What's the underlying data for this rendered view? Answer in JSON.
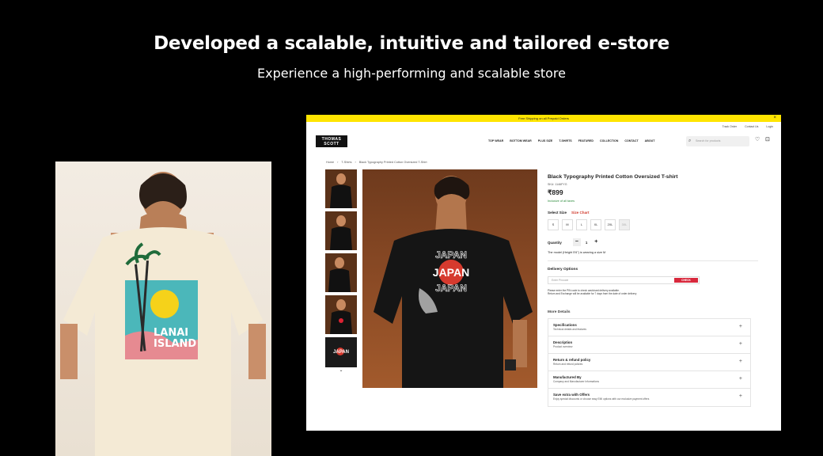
{
  "hero": {
    "title": "Developed a scalable, intuitive and tailored e-store",
    "subtitle": "Experience a high-performing and scalable store"
  },
  "left_photo": {
    "print_text_line1": "LANAI",
    "print_text_line2": "ISLAND"
  },
  "site": {
    "promo": "Free Shipping on all Prepaid Orders",
    "promo_close": "×",
    "top_links": [
      "Track Order",
      "Contact Us",
      "Login"
    ],
    "logo_line1": "THOMAS",
    "logo_line2": "SCOTT",
    "nav": [
      "TOP WEAR",
      "BOTTOM WEAR",
      "PLUS SIZE",
      "T-SHIRTS",
      "FEATURED",
      "COLLECTION",
      "CONTACT",
      "ABOUT"
    ],
    "search_placeholder": "Search for products",
    "breadcrumbs": [
      "Home",
      "T-Shirts",
      "Black Typography Printed Cotton Oversized T-Shirt"
    ],
    "print_text": "JAPAN",
    "product": {
      "title": "Black Typography Printed Cotton Oversized T-shirt",
      "sku": "SKU: 1146FYG",
      "price": "₹899",
      "inclusive": "Inclusive of all taxes",
      "select_size": "Select Size",
      "size_chart": "Size Chart",
      "sizes": [
        "S",
        "M",
        "L",
        "XL",
        "2XL",
        "3XL"
      ],
      "quantity_label": "Quantity",
      "quantity_value": "1",
      "model_note": "The model (Height 5'6\") is wearing a size M",
      "delivery_title": "Delivery Options",
      "pincode_placeholder": "Enter Pincode",
      "check_label": "CHECK",
      "delivery_note1": "Please enter the PIN code to check cash/card delivery available.",
      "delivery_note2": "Return and Exchange will be available for 7 days from the date of order delivery",
      "more_details": "More Details",
      "accordion": [
        {
          "title": "Specifications",
          "sub": "Technical details and features"
        },
        {
          "title": "Description",
          "sub": "Product overview"
        },
        {
          "title": "Return & refund policy",
          "sub": "Return and refund policies"
        },
        {
          "title": "Manufactured By",
          "sub": "Company and Manufacturer Informations"
        },
        {
          "title": "Save extra with Offers",
          "sub": "Enjoy special discounts or choose easy EMI options with our exclusive payment offers"
        }
      ]
    }
  }
}
